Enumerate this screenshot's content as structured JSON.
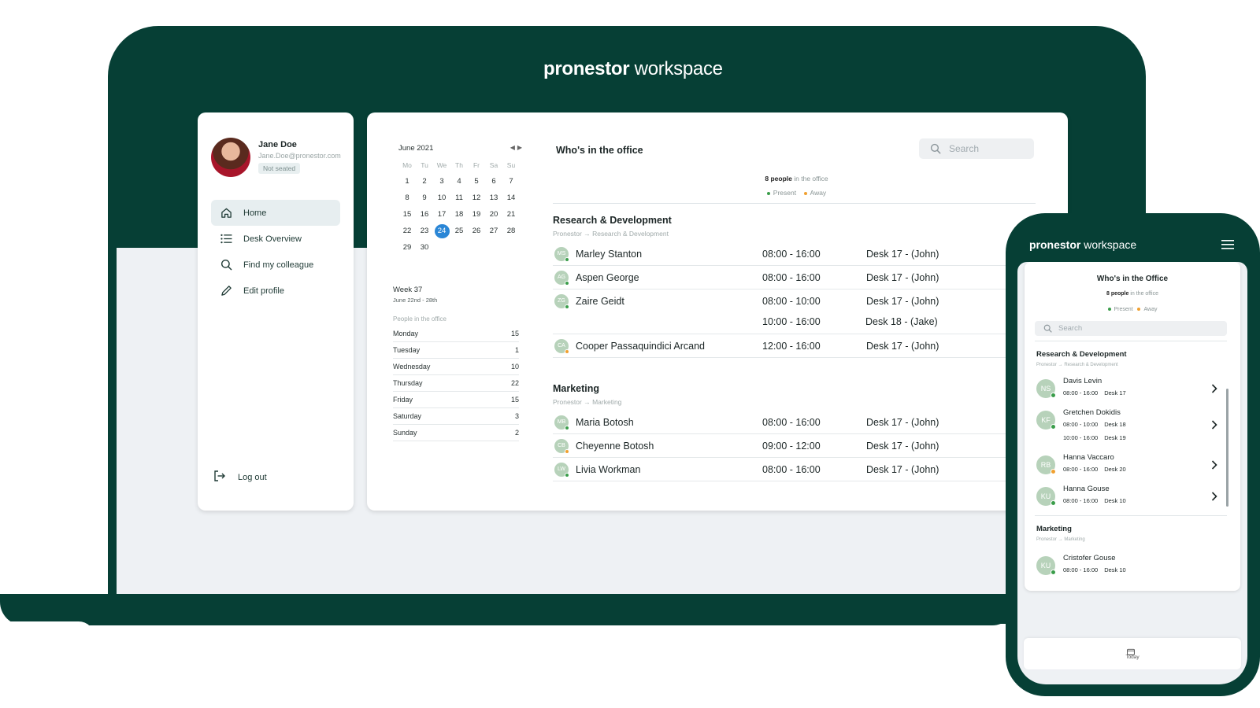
{
  "brand": {
    "bold": "pronestor",
    "light": " workspace"
  },
  "user": {
    "name": "Jane Doe",
    "email": "Jane.Doe@pronestor.com",
    "status": "Not seated"
  },
  "nav": [
    {
      "label": "Home",
      "icon": "home-icon"
    },
    {
      "label": "Desk Overview",
      "icon": "list-icon"
    },
    {
      "label": "Find my colleague",
      "icon": "search-icon"
    },
    {
      "label": "Edit profile",
      "icon": "pencil-icon"
    }
  ],
  "logout": "Log out",
  "calendar": {
    "month": "June 2021",
    "dows": [
      "Mo",
      "Tu",
      "We",
      "Th",
      "Fr",
      "Sa",
      "Su"
    ],
    "selected": "24",
    "days": [
      "1",
      "2",
      "3",
      "4",
      "5",
      "6",
      "7",
      "8",
      "9",
      "10",
      "11",
      "12",
      "13",
      "14",
      "15",
      "16",
      "17",
      "18",
      "19",
      "20",
      "21",
      "22",
      "23",
      "24",
      "25",
      "26",
      "27",
      "28",
      "29",
      "30"
    ]
  },
  "week": {
    "title": "Week 37",
    "range": "June 22nd - 28th",
    "subtitle": "People in the office",
    "rows": [
      {
        "day": "Monday",
        "count": "15"
      },
      {
        "day": "Tuesday",
        "count": "1"
      },
      {
        "day": "Wednesday",
        "count": "10"
      },
      {
        "day": "Thursday",
        "count": "22"
      },
      {
        "day": "Friday",
        "count": "15"
      },
      {
        "day": "Saturday",
        "count": "3"
      },
      {
        "day": "Sunday",
        "count": "2"
      }
    ]
  },
  "office": {
    "title": "Who's in the office",
    "search_placeholder": "Search",
    "count_bold": "8 people",
    "count_rest": " in the office",
    "legend_present": "Present",
    "legend_away": "Away"
  },
  "departments": [
    {
      "name": "Research & Development",
      "path": "Pronestor → Research & Development",
      "people": [
        {
          "initials": "MS",
          "name": "Marley Stanton",
          "status": "present",
          "slots": [
            {
              "time": "08:00 - 16:00",
              "desk": "Desk 17 - (John)"
            }
          ]
        },
        {
          "initials": "AG",
          "name": "Aspen George",
          "status": "present",
          "slots": [
            {
              "time": "08:00 - 16:00",
              "desk": "Desk 17 - (John)"
            }
          ]
        },
        {
          "initials": "ZG",
          "name": "Zaire Geidt",
          "status": "present",
          "slots": [
            {
              "time": "08:00 - 10:00",
              "desk": "Desk 17 - (John)"
            },
            {
              "time": "10:00 - 16:00",
              "desk": "Desk 18 - (Jake)"
            }
          ]
        },
        {
          "initials": "CA",
          "name": "Cooper Passaquindici Arcand",
          "status": "away",
          "slots": [
            {
              "time": "12:00 - 16:00",
              "desk": "Desk 17 - (John)"
            }
          ]
        }
      ]
    },
    {
      "name": "Marketing",
      "path": "Pronestor → Marketing",
      "people": [
        {
          "initials": "MB",
          "name": "Maria Botosh",
          "status": "present",
          "slots": [
            {
              "time": "08:00 - 16:00",
              "desk": "Desk 17 - (John)"
            }
          ]
        },
        {
          "initials": "CB",
          "name": "Cheyenne Botosh",
          "status": "away",
          "slots": [
            {
              "time": "09:00 - 12:00",
              "desk": "Desk 17 - (John)"
            }
          ]
        },
        {
          "initials": "LW",
          "name": "Livia Workman",
          "status": "present",
          "slots": [
            {
              "time": "08:00 - 16:00",
              "desk": "Desk 17 - (John)"
            }
          ]
        }
      ]
    }
  ],
  "phone": {
    "title": "Who's in the Office",
    "count_bold": "8 people",
    "count_rest": " in the office",
    "legend_present": "Present",
    "legend_away": "Away",
    "search_placeholder": "Search",
    "departments": [
      {
        "name": "Research & Development",
        "path": "Pronestor → Research & Development",
        "people": [
          {
            "initials": "NS",
            "name": "Davis Levin",
            "status": "present",
            "slots": [
              {
                "time": "08:00 - 16:00",
                "desk": "Desk 17"
              }
            ]
          },
          {
            "initials": "KF",
            "name": "Gretchen Dokidis",
            "status": "present",
            "slots": [
              {
                "time": "08:00 - 10:00",
                "desk": "Desk 18"
              },
              {
                "time": "10:00 - 16:00",
                "desk": "Desk 19"
              }
            ]
          },
          {
            "initials": "RB",
            "name": "Hanna Vaccaro",
            "status": "away",
            "slots": [
              {
                "time": "08:00 - 16:00",
                "desk": "Desk 20"
              }
            ]
          },
          {
            "initials": "KU",
            "name": "Hanna Gouse",
            "status": "present",
            "slots": [
              {
                "time": "08:00 - 16:00",
                "desk": "Desk 10"
              }
            ]
          }
        ]
      },
      {
        "name": "Marketing",
        "path": "Pronestor → Marketing",
        "people": [
          {
            "initials": "KU",
            "name": "Cristofer Gouse",
            "status": "present",
            "slots": [
              {
                "time": "08:00 - 16:00",
                "desk": "Desk 10"
              }
            ]
          }
        ]
      }
    ],
    "today_label": "Today"
  },
  "colors": {
    "brand_green": "#063f35",
    "present": "#3a9d4a",
    "away": "#f0a030",
    "selected_day": "#2a86d6"
  }
}
